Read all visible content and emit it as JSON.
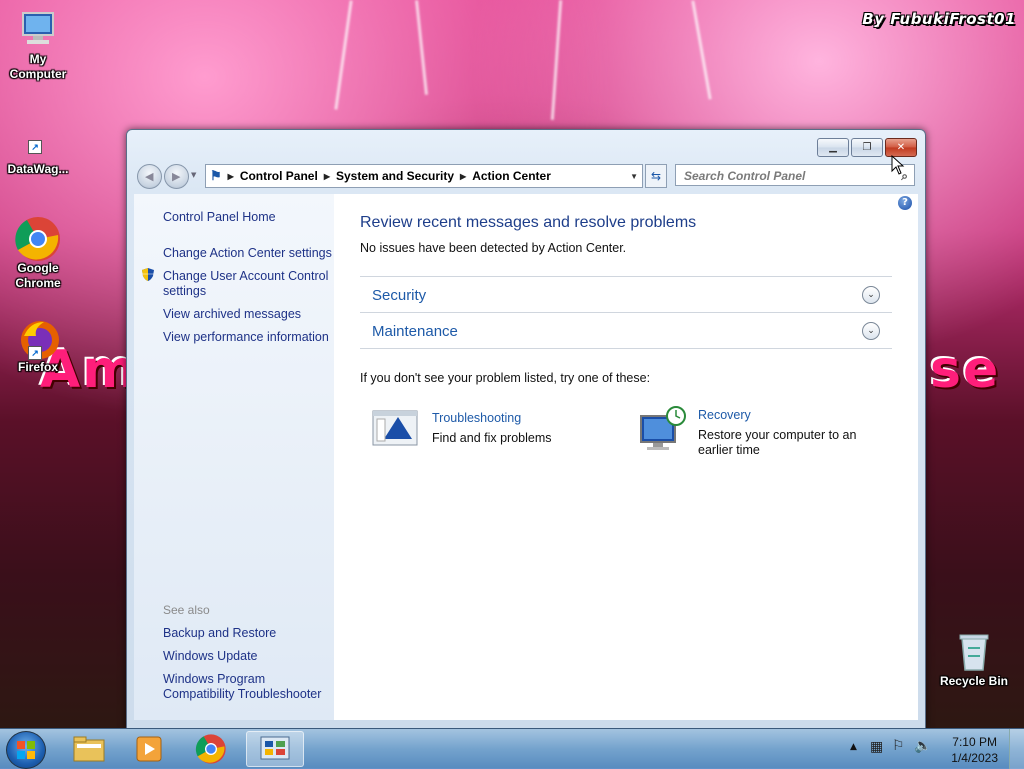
{
  "desktop": {
    "watermark": "By FubukiFrost01",
    "icons": {
      "my_computer": "My Computer",
      "datawag": "DataWag...",
      "chrome": "Google Chrome",
      "firefox": "Firefox",
      "recycle_bin": "Recycle Bin"
    }
  },
  "window": {
    "address": {
      "seg1": "Control Panel",
      "seg2": "System and Security",
      "seg3": "Action Center"
    },
    "search_placeholder": "Search Control Panel",
    "sidebar": {
      "home": "Control Panel Home",
      "links": [
        "Change Action Center settings",
        "Change User Account Control settings",
        "View archived messages",
        "View performance information"
      ],
      "see_also_label": "See also",
      "see_also": [
        "Backup and Restore",
        "Windows Update",
        "Windows Program Compatibility Troubleshooter"
      ]
    },
    "main": {
      "title": "Review recent messages and resolve problems",
      "status": "No issues have been detected by Action Center.",
      "sections": [
        "Security",
        "Maintenance"
      ],
      "try_text": "If you don't see your problem listed, try one of these:",
      "tools": [
        {
          "name": "Troubleshooting",
          "desc": "Find and fix problems"
        },
        {
          "name": "Recovery",
          "desc": "Restore your computer to an earlier time"
        }
      ]
    }
  },
  "taskbar": {
    "time": "7:10 PM",
    "date": "1/4/2023"
  }
}
